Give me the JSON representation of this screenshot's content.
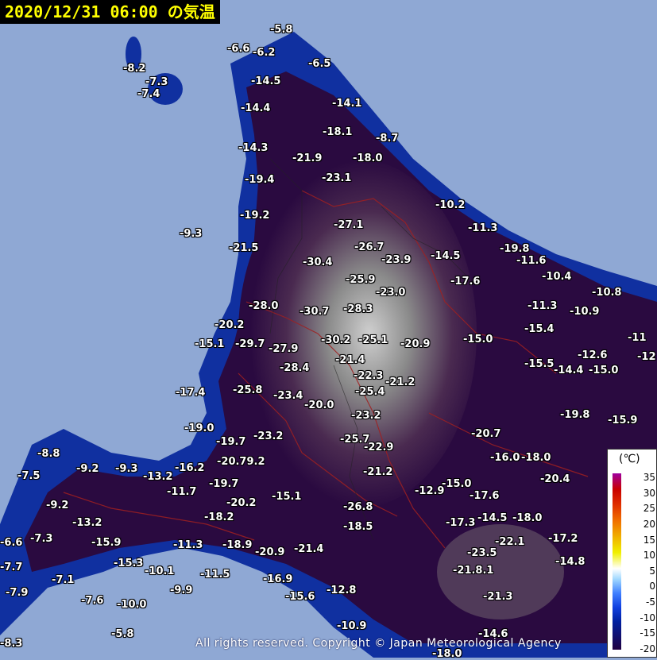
{
  "title": "2020/12/31 06:00 の気温",
  "copyright": "All rights reserved. Copyright © Japan Meteorological Agency",
  "legend": {
    "unit": "(℃)",
    "ticks": [
      "35",
      "30",
      "25",
      "20",
      "15",
      "10",
      "5",
      "0",
      "-5",
      "-10",
      "-15",
      "-20"
    ]
  },
  "colors": {
    "sea": "#8fa8d4",
    "cold": "#2a0a40",
    "coast": "#1030a0"
  },
  "temperatures": [
    "-5.8",
    "-6.6",
    "-6.2",
    "-6.5",
    "-8.2",
    "-7.3",
    "-7.4",
    "-14.5",
    "-14.4",
    "-14.1",
    "-18.1",
    "-8.7",
    "-14.3",
    "-21.9",
    "-18.0",
    "-19.4",
    "-23.1",
    "-10.2",
    "-19.2",
    "-27.1",
    "-11.3",
    "-9.3",
    "-21.5",
    "-26.7",
    "-14.5",
    "-19.8",
    "-11.6",
    "-30.4",
    "-23.9",
    "-25.9",
    "-17.6",
    "-10.4",
    "-23.0",
    "-10.8",
    "-28.0",
    "-30.7",
    "-28.3",
    "-11.3",
    "-10.9",
    "-20.2",
    "-15.4",
    "-15.1",
    "-29.7",
    "-27.9",
    "-30.2",
    "-25.1",
    "-20.9",
    "-15.0",
    "-11",
    "-12.6",
    "-12",
    "-21.4",
    "-15.5",
    "-14.4",
    "-15.0",
    "-28.4",
    "-22.3",
    "-21.2",
    "-17.4",
    "-25.8",
    "-23.4",
    "-25.4",
    "-20.0",
    "-19.8",
    "-23.2",
    "-15.9",
    "-19.0",
    "-19.7",
    "-23.2",
    "-20.7",
    "-25.7",
    "-22.9",
    "-8.8",
    "-16.0",
    "-18.0",
    "-20.79.2",
    "-9.2",
    "-9.3",
    "-16.2",
    "-7.5",
    "-13.2",
    "-21.2",
    "-20.4",
    "-19.7",
    "-11.7",
    "-12.9",
    "-15.0",
    "-17.6",
    "-15.1",
    "-9.2",
    "-20.2",
    "-26.8",
    "-13.2",
    "-18.2",
    "-17.3",
    "-14.5",
    "-18.0",
    "-7.3",
    "-18.5",
    "-6.6",
    "-15.9",
    "-11.3",
    "-18.9",
    "-22.1",
    "-17.2",
    "-21.4",
    "-20.9",
    "-23.5",
    "-7.7",
    "-15.3",
    "-10.1",
    "-11.5",
    "-21.8.1",
    "-14.8",
    "-7.1",
    "-16.9",
    "-9.9",
    "-7.9",
    "-15.6",
    "-12.8",
    "-21.3",
    "-7.6",
    "-10.0",
    "-10.9",
    "-5.8",
    "-14.6",
    "-8.3",
    "-18.0"
  ]
}
